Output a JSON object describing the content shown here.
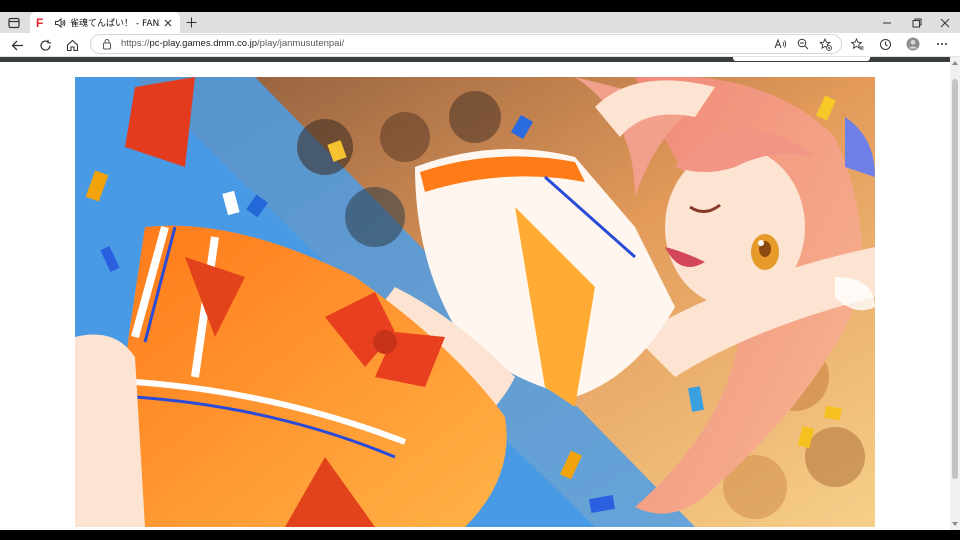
{
  "browser": {
    "tab": {
      "favicon": "F",
      "title": "雀魂てんぱい！ - FANZA GAMES",
      "audio_icon": "speaker-icon"
    },
    "url": {
      "scheme": "https://",
      "host": "pc-play.games.dmm.co.jp",
      "path": "/play/janmusutenpai/"
    },
    "colors": {
      "favicon": "#e2232a",
      "tab_strip": "#dfdfdf",
      "page_strip": "#3a3e3b"
    }
  },
  "game": {
    "scene": "anime cheerleader girl with pink hair in orange uniform, winking, stadium crowd and confetti background"
  }
}
